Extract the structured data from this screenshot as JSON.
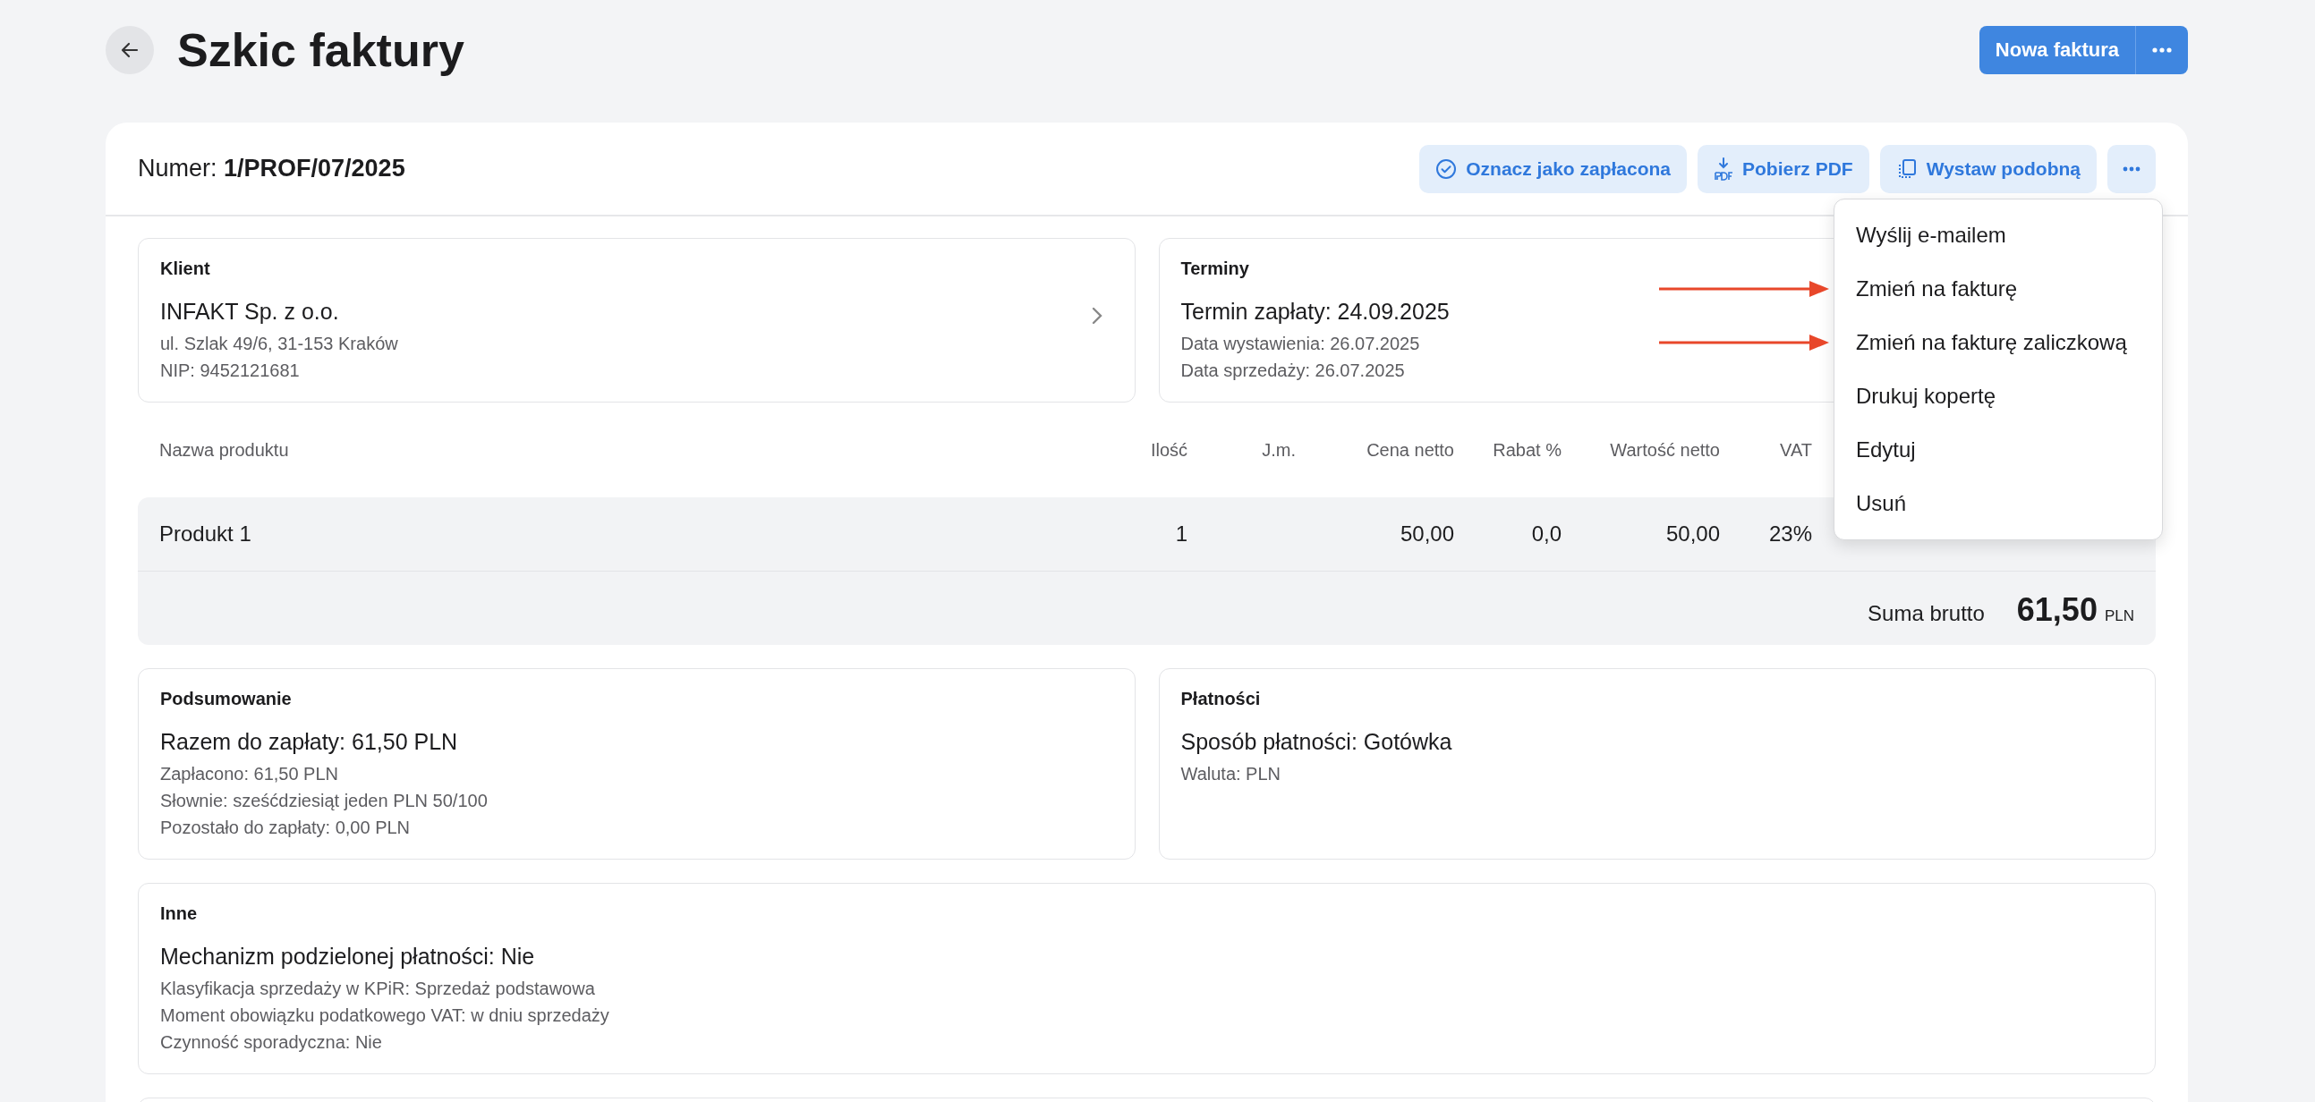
{
  "header": {
    "title": "Szkic faktury",
    "primary_button": "Nowa faktura"
  },
  "invoice": {
    "number": "Numer: **1/PROF/07/2025**",
    "actions": [
      {
        "kind": "paid",
        "label": "Oznacz jako zapłacona"
      },
      {
        "kind": "pdf",
        "label": "Pobierz PDF"
      },
      {
        "kind": "copy",
        "label": "Wystaw podobną"
      }
    ]
  },
  "menu": {
    "items": [
      {
        "label": "Wyślij e-mailem",
        "annotated": false
      },
      {
        "label": "Zmień na fakturę",
        "annotated": true
      },
      {
        "label": "Zmień na fakturę zaliczkową",
        "annotated": true
      },
      {
        "label": "Drukuj kopertę",
        "annotated": false
      },
      {
        "label": "Edytuj",
        "annotated": false
      },
      {
        "label": "Usuń",
        "annotated": false
      }
    ]
  },
  "top_sections": [
    {
      "title": "Klient",
      "main": "INFAKT Sp. z o.o.",
      "details": [
        "ul. Szlak 49/6, 31-153 Kraków",
        "NIP: 9452121681"
      ],
      "link": true
    },
    {
      "title": "Terminy",
      "main": "Termin zapłaty: 24.09.2025",
      "details": [
        "Data wystawienia: 26.07.2025",
        "Data sprzedaży: 26.07.2025"
      ],
      "link": false
    }
  ],
  "table": {
    "columns": [
      "Nazwa produktu",
      "Ilość",
      "J.m.",
      "Cena netto",
      "Rabat %",
      "Wartość netto",
      "VAT"
    ],
    "rows": [
      {
        "cells": [
          "Produkt 1",
          "1",
          null,
          "50,00",
          "0,0",
          "50,00",
          "23%"
        ]
      }
    ],
    "total": {
      "label": "Suma brutto",
      "value": "61,50",
      "currency": "PLN"
    }
  },
  "bottom_sections": [
    {
      "title": "Podsumowanie",
      "main": "Razem do zapłaty: 61,50 PLN",
      "details": [
        "Zapłacono: 61,50 PLN",
        "Słownie: sześćdziesiąt jeden PLN 50/100",
        "Pozostało do zapłaty: 0,00 PLN"
      ]
    },
    {
      "title": "Płatności",
      "main": "Sposób płatności: Gotówka",
      "details": [
        "Waluta: PLN"
      ]
    }
  ],
  "other": {
    "title": "Inne",
    "main": "Mechanizm podzielonej płatności: Nie",
    "details": [
      "Klasyfikacja sprzedaży w KPiR: Sprzedaż podstawowa",
      "Moment obowiązku podatkowego VAT: w dniu sprzedaży",
      "Czynność sporadyczna: Nie"
    ]
  }
}
